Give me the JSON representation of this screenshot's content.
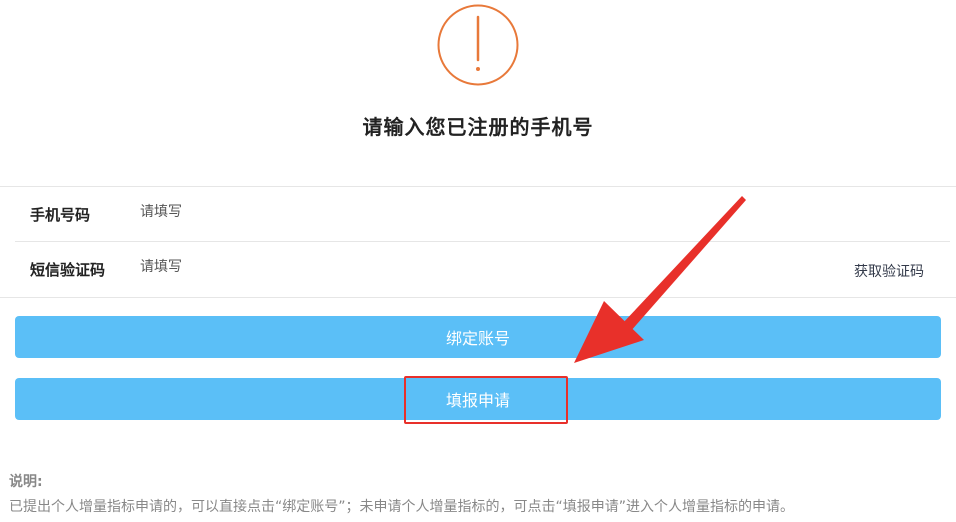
{
  "header": {
    "icon": "exclamation-circle-icon",
    "title": "请输入您已注册的手机号"
  },
  "form": {
    "phone": {
      "label": "手机号码",
      "placeholder": "请填写",
      "value": ""
    },
    "sms_code": {
      "label": "短信验证码",
      "placeholder": "请填写",
      "value": "",
      "get_code_label": "获取验证码"
    }
  },
  "actions": {
    "bind_label": "绑定账号",
    "apply_label": "填报申请"
  },
  "note": {
    "title": "说明:",
    "text": "已提出个人增量指标申请的，可以直接点击“绑定账号”；未申请个人增量指标的，可点击“填报申请”进入个人增量指标的申请。"
  },
  "colors": {
    "icon_orange": "#e8793a",
    "button_blue": "#5bbff7",
    "annotation_red": "#e8302a"
  }
}
